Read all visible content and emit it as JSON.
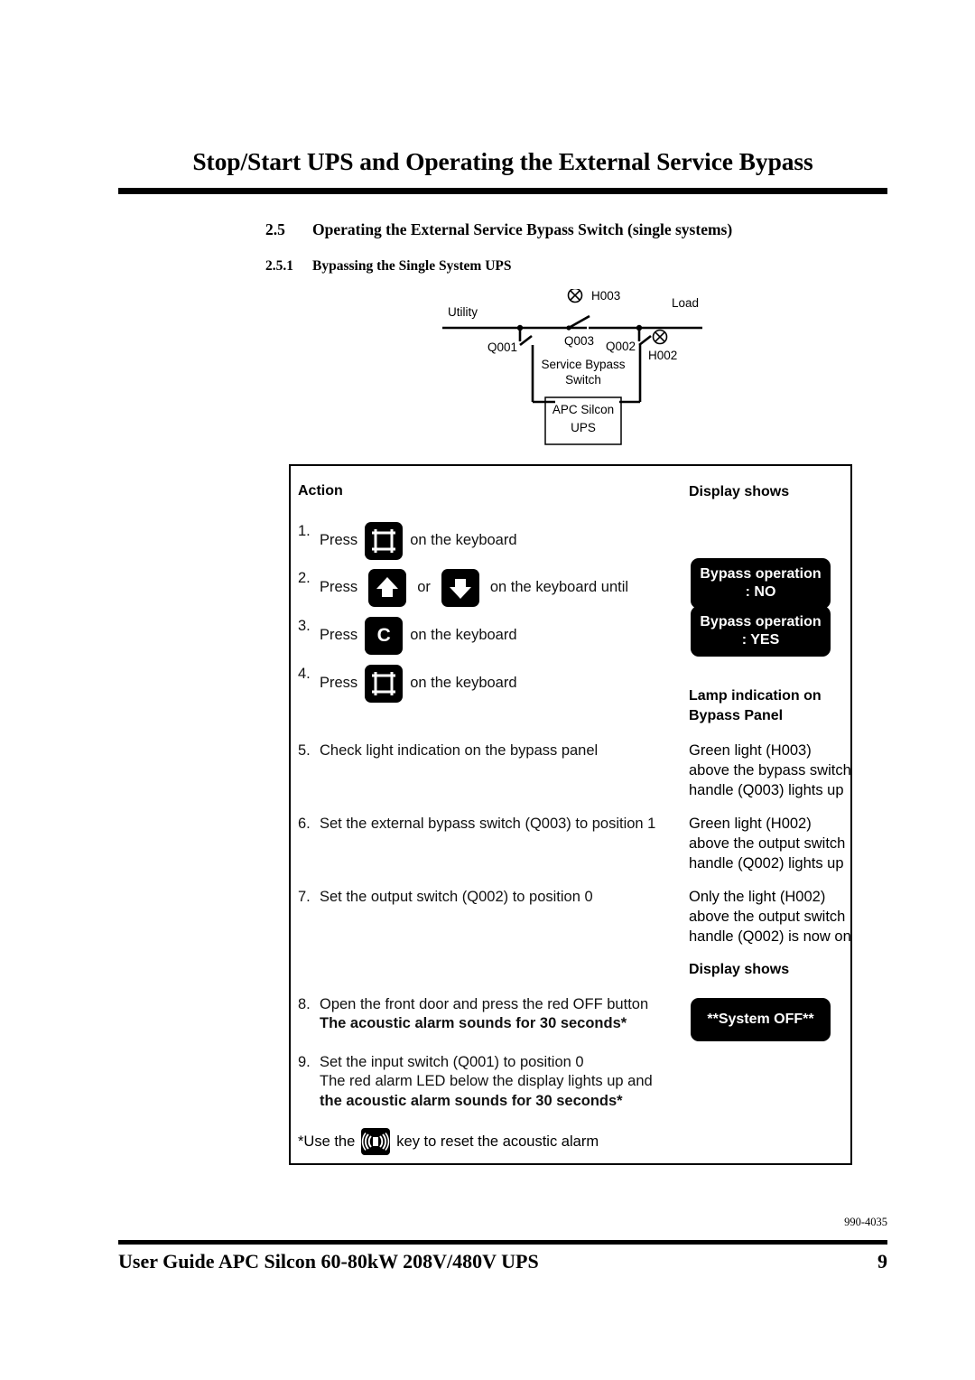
{
  "document": {
    "chapter_title": "Stop/Start UPS and Operating the External Service Bypass",
    "section": {
      "number": "2.5",
      "title": "Operating the External Service Bypass Switch (single systems)"
    },
    "subsection": {
      "number": "2.5.1",
      "title": "Bypassing the Single System UPS"
    }
  },
  "diagram": {
    "name": "single-system-bypass-circuit",
    "labels": {
      "utility": "Utility",
      "load": "Load",
      "h003": "H003",
      "h002": "H002",
      "q001": "Q001",
      "q002": "Q002",
      "q003": "Q003",
      "service_bypass": "Service Bypass",
      "switch": "Switch",
      "ups_line1": "APC Silcon",
      "ups_line2": "UPS"
    }
  },
  "table": {
    "headers": {
      "action": "Action",
      "display_shows": "Display shows",
      "lamp_indication": "Lamp indication on",
      "lamp_indication_2": "Bypass Panel",
      "display_shows_2": "Display shows"
    },
    "steps": [
      {
        "index": "1.",
        "lead": "Press",
        "key_icon": "display-frame-key-icon",
        "trail": "on the keyboard"
      },
      {
        "index": "2.",
        "lead": "Press",
        "key_icon": "arrow-up-key-icon",
        "conjunction": "or",
        "key_icon_2": "arrow-down-key-icon",
        "trail": "on the keyboard until"
      },
      {
        "index": "3.",
        "lead": "Press",
        "key_icon": "c-key-icon",
        "key_label": "C",
        "trail": "on the keyboard"
      },
      {
        "index": "4.",
        "lead": "Press",
        "key_icon": "display-frame-key-icon",
        "trail": "on the keyboard"
      },
      {
        "index": "5.",
        "text": "Check light indication on the bypass panel"
      },
      {
        "index": "6.",
        "text": "Set the external bypass switch (Q003) to position 1"
      },
      {
        "index": "7.",
        "text": "Set the output switch (Q002) to position 0"
      },
      {
        "index": "8.",
        "text": "Open the front door and press the red OFF button",
        "bold_text": "The acoustic alarm sounds for 30 seconds*"
      },
      {
        "index": "9.",
        "text": "Set the input switch (Q001) to position 0",
        "text2": "The red alarm LED below the display lights up and",
        "bold_text": "the acoustic alarm sounds for 30 seconds*"
      }
    ],
    "lcd_panels": [
      {
        "line1": "Bypass operation",
        "line2": ": NO"
      },
      {
        "line1": "Bypass operation",
        "line2": ": YES"
      },
      {
        "line1": "**System OFF**",
        "line2": ""
      }
    ],
    "results": [
      {
        "lines": [
          "Green light (H003)",
          "above the bypass switch",
          "handle (Q003) lights up"
        ]
      },
      {
        "lines": [
          "Green light (H002)",
          "above the output switch",
          "handle (Q002) lights up"
        ]
      },
      {
        "lines": [
          "Only the light (H002)",
          "above the output switch",
          "handle (Q002) is now on"
        ]
      }
    ],
    "footnote": {
      "before": "*Use the",
      "icon": "acoustic-alarm-key-icon",
      "after": "key  to reset the acoustic alarm"
    }
  },
  "footer": {
    "doc_code": "990-4035",
    "guide_title": "User Guide APC Silcon 60-80kW 208V/480V UPS",
    "page_number": "9"
  },
  "colors": {
    "ink": "#000000",
    "paper": "#ffffff"
  }
}
